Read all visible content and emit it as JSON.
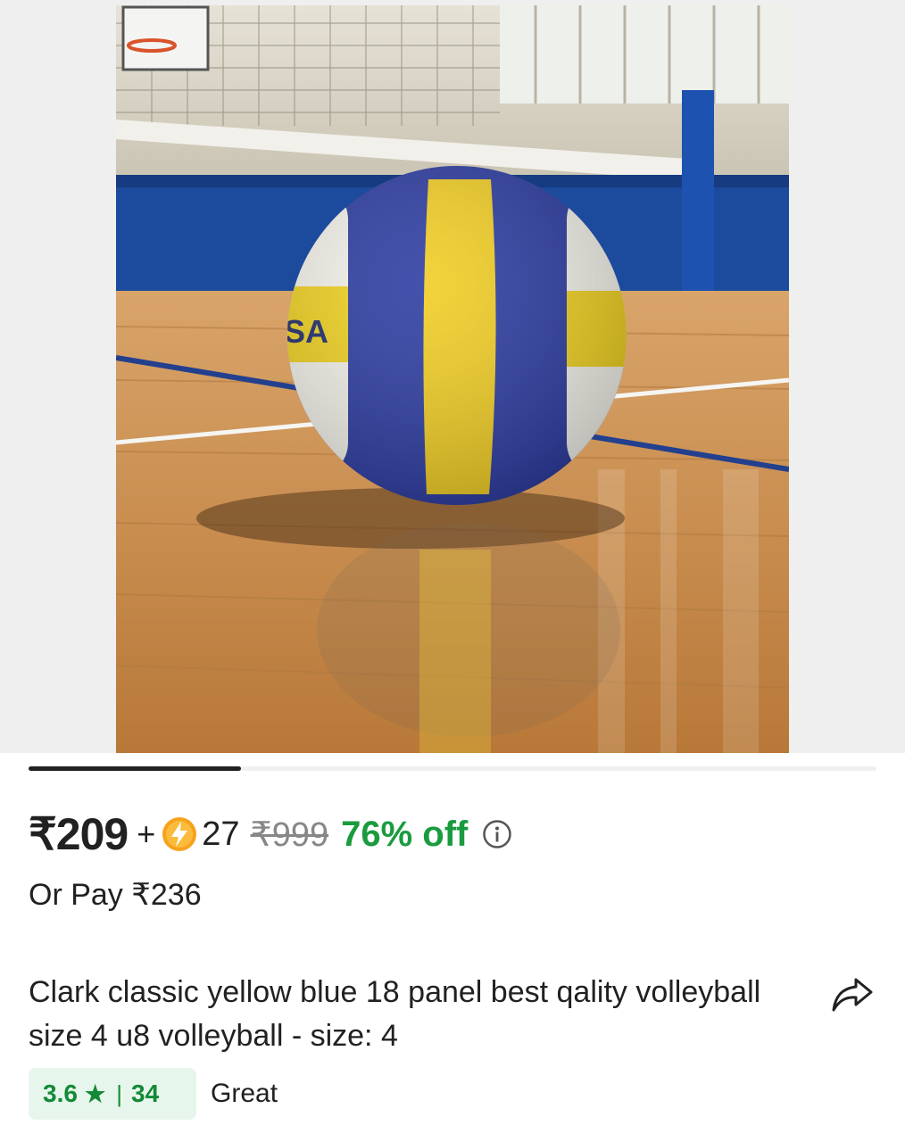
{
  "product": {
    "price": "₹209",
    "plus": "+",
    "coins": "27",
    "mrp": "₹999",
    "discount": "76% off",
    "alt_pay": "Or Pay ₹236",
    "title": "Clark classic yellow blue 18 panel best qality volleyball size 4 u8 volleyball - size: 4",
    "rating": "3.6",
    "star": "★",
    "separator": "|",
    "rating_count": "34",
    "rating_word": "Great",
    "photo_ball_text": "SA"
  },
  "carousel": {
    "progress": 0.25
  },
  "icons": {
    "coin": "lightning-coin-icon",
    "info": "info-icon",
    "share": "share-icon",
    "star": "star-icon"
  },
  "colors": {
    "discount": "#1a9b3e",
    "rating_bg": "#e7f6ec",
    "rating_text": "#138a36",
    "coin": "#f7a21b",
    "mrp": "#878787"
  }
}
